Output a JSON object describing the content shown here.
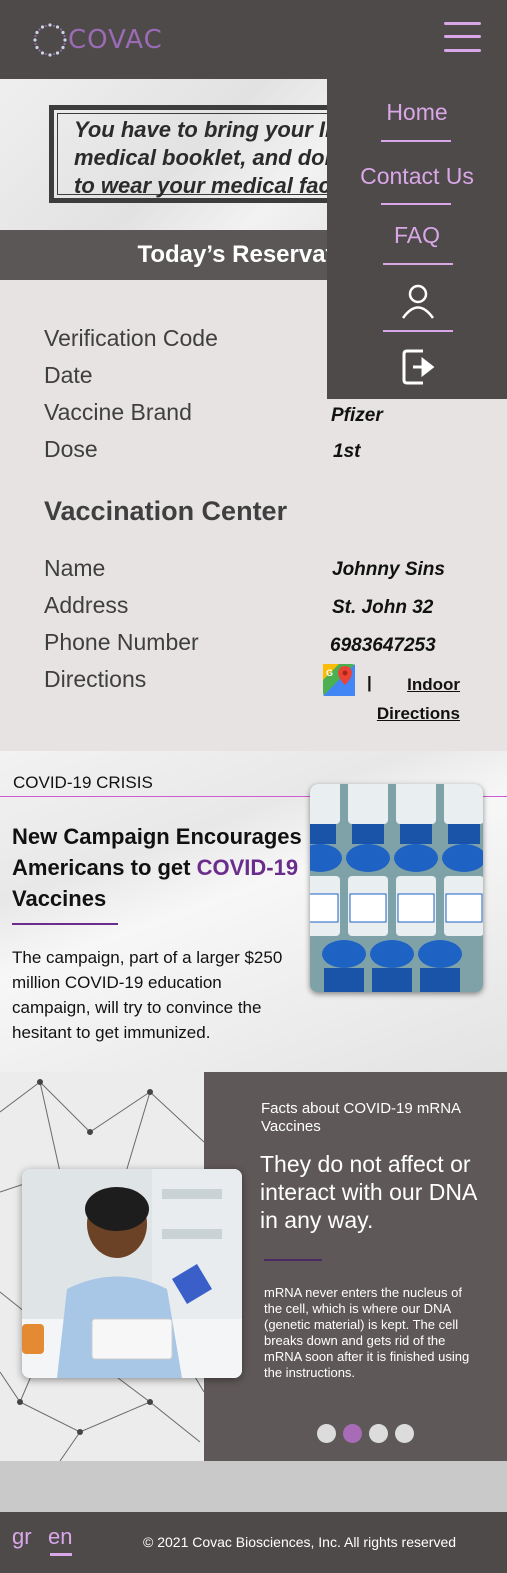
{
  "header": {
    "logo_text": "COVAC"
  },
  "notice": {
    "text": "You have to bring your ID, medical booklet, and don't forget to wear your medical face mask"
  },
  "reservation": {
    "title": "Today’s Reservation",
    "fields": [
      {
        "label": "Verification Code",
        "value": ""
      },
      {
        "label": "Date",
        "value": ""
      },
      {
        "label": "Vaccine Brand",
        "value": "Pfizer"
      },
      {
        "label": "Dose",
        "value": "1st"
      }
    ],
    "center_title": "Vaccination Center",
    "center_fields": [
      {
        "label": "Name",
        "value": "Johnny Sins"
      },
      {
        "label": "Address",
        "value": "St. John 32"
      },
      {
        "label": "Phone Number",
        "value": "6983647253"
      },
      {
        "label": "Directions",
        "value": ""
      }
    ],
    "indoor_directions": "Indoor Directions",
    "separator": "|"
  },
  "news": {
    "kicker": "COVID-19 CRISIS",
    "title_start": "New Campaign Encourages Americans to get ",
    "title_accent": "COVID-19",
    "title_end": " Vaccines",
    "body": "The campaign, part of a larger $250 million COVID-19 education campaign, will try to convince the hesitant to get immunized."
  },
  "facts": {
    "kicker": "Facts about COVID-19 mRNA Vaccines",
    "heading": "They do not affect or interact with our DNA in any way.",
    "body": "mRNA never enters the nucleus of the cell, which is where our DNA (genetic material) is kept. The cell breaks down and gets rid of the mRNA soon after it is finished using the instructions.",
    "slides": 4,
    "active_slide": 2
  },
  "footer": {
    "lang_gr": "gr",
    "lang_en": "en",
    "active_lang": "en",
    "copyright": "© 2021 Covac Biosciences, Inc. All rights reserved"
  },
  "nav": {
    "items": [
      "Home",
      "Contact Us",
      "FAQ"
    ],
    "icons": [
      "user-icon",
      "logout-icon"
    ]
  },
  "colors": {
    "accent": "#d9a7e8",
    "brand_purple": "#6b2d8c",
    "dark_bg": "#4f4a4a"
  }
}
